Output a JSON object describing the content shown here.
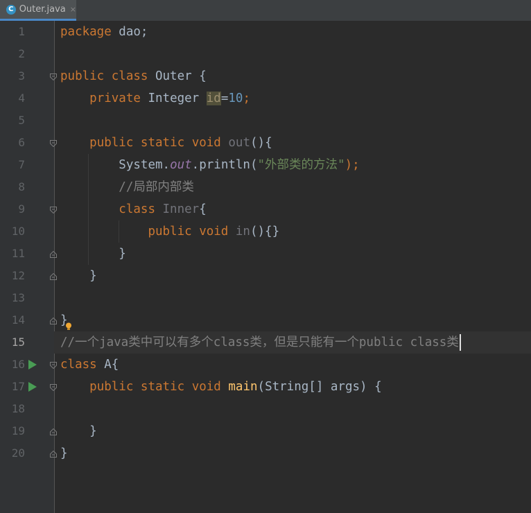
{
  "tab": {
    "icon": "java-class-icon",
    "title": "Outer.java",
    "close": "×"
  },
  "editor": {
    "current_line": 15,
    "line_numbers": [
      "1",
      "2",
      "3",
      "4",
      "5",
      "6",
      "7",
      "8",
      "9",
      "10",
      "11",
      "12",
      "13",
      "14",
      "15",
      "16",
      "17",
      "18",
      "19",
      "20"
    ],
    "code": {
      "l1": {
        "kw": "package",
        "rest": " dao;"
      },
      "l3": {
        "kw1": "public",
        "kw2": "class",
        "rest": " Outer {"
      },
      "l4": {
        "kw": "private",
        "type": " Integer ",
        "id": "id",
        "eq": "=",
        "num": "10",
        "semi": ";"
      },
      "l6": {
        "kw1": "public",
        "kw2": "static",
        "kw3": "void",
        "name": " out",
        "rest": "(){"
      },
      "l7": {
        "a": "System.",
        "field": "out",
        "b": ".println(",
        "str": "\"外部类的方法\"",
        "c": ");"
      },
      "l8": {
        "comment": "//局部内部类"
      },
      "l9": {
        "kw": "class",
        "name": " Inner",
        "rest": "{"
      },
      "l10": {
        "kw1": "public",
        "kw2": "void",
        "name": " in",
        "rest": "(){}"
      },
      "l11": {
        "rest": "}"
      },
      "l12": {
        "rest": "}"
      },
      "l14": {
        "rest": "}"
      },
      "l15": {
        "comment": "//一个java类中可以有多个class类，但是只能有一个public class类"
      },
      "l16": {
        "kw": "class",
        "rest": " A{"
      },
      "l17": {
        "kw1": "public",
        "kw2": "static",
        "kw3": "void",
        "fn": " main",
        "rest": "(String[] args) {"
      },
      "l19": {
        "rest": "}"
      },
      "l20": {
        "rest": "}"
      }
    }
  },
  "colors": {
    "background": "#2b2b2b",
    "gutter": "#313335",
    "keyword": "#cc7832",
    "string": "#6a8759",
    "number": "#6897bb",
    "comment": "#808080",
    "method": "#ffc66d",
    "static_field": "#9876aa",
    "run_icon": "#499c54"
  }
}
